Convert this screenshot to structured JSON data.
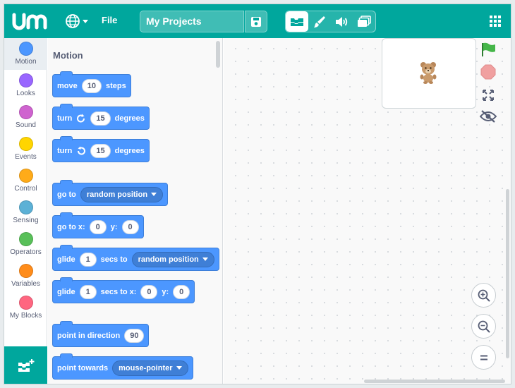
{
  "header": {
    "file_label": "File",
    "project_title": "My Projects",
    "icons": [
      "logo",
      "globe-icon",
      "save-icon",
      "code-tab-icon",
      "costumes-tab-icon",
      "sounds-tab-icon",
      "stage-tab-icon",
      "grid-menu-icon"
    ]
  },
  "categories": [
    {
      "label": "Motion",
      "color": "#4c97ff"
    },
    {
      "label": "Looks",
      "color": "#9966ff"
    },
    {
      "label": "Sound",
      "color": "#cf63cf"
    },
    {
      "label": "Events",
      "color": "#ffd500"
    },
    {
      "label": "Control",
      "color": "#ffab19"
    },
    {
      "label": "Sensing",
      "color": "#5cb1d6"
    },
    {
      "label": "Operators",
      "color": "#59c059"
    },
    {
      "label": "Variables",
      "color": "#ff8c1a"
    },
    {
      "label": "My Blocks",
      "color": "#ff6680"
    }
  ],
  "palette": {
    "title": "Motion",
    "blocks": {
      "move": {
        "label": "move",
        "value": "10",
        "suffix": "steps"
      },
      "turn_right": {
        "label": "turn",
        "value": "15",
        "suffix": "degrees"
      },
      "turn_left": {
        "label": "turn",
        "value": "15",
        "suffix": "degrees"
      },
      "goto": {
        "label": "go to",
        "dropdown": "random position"
      },
      "goto_xy": {
        "label": "go to x:",
        "x": "0",
        "y_label": "y:",
        "y": "0"
      },
      "glide_to": {
        "label": "glide",
        "value": "1",
        "mid": "secs to",
        "dropdown": "random position"
      },
      "glide_xy": {
        "label": "glide",
        "value": "1",
        "mid": "secs to x:",
        "x": "0",
        "y_label": "y:",
        "y": "0"
      },
      "point_direction": {
        "label": "point in direction",
        "value": "90"
      },
      "point_towards": {
        "label": "point towards",
        "dropdown": "mouse-pointer"
      }
    }
  },
  "colors": {
    "brand": "#00a79d",
    "motion": "#4c97ff",
    "green_flag": "#45b649",
    "stop": "#f0a0a0"
  },
  "stage_controls": [
    "green-flag-icon",
    "stop-icon",
    "fullscreen-icon",
    "hide-stage-icon"
  ],
  "zoom_controls": [
    "zoom-in-icon",
    "zoom-out-icon",
    "zoom-reset-icon"
  ]
}
